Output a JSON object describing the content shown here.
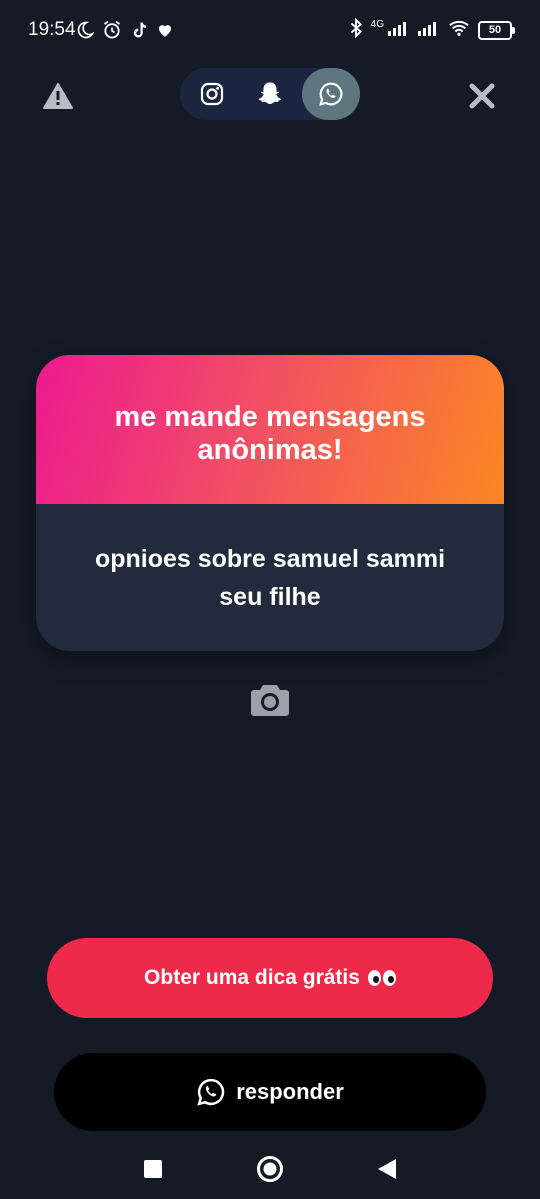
{
  "status_bar": {
    "time": "19:54",
    "network_tag": "4G",
    "battery": "50"
  },
  "share_bar": {
    "icons": [
      "instagram-icon",
      "snapchat-icon",
      "whatsapp-icon"
    ],
    "active": "whatsapp-icon"
  },
  "card": {
    "title": "me mande mensagens anônimas!",
    "message": "opnioes sobre samuel sammi seu filhe"
  },
  "hint_button": {
    "label": "Obter uma dica grátis"
  },
  "reply_button": {
    "label": "responder"
  },
  "colors": {
    "background": "#151a27",
    "card_body": "#212b3d",
    "gradient_start": "#ec1a8f",
    "gradient_end": "#fb8723",
    "hint_button": "#ee2a4a",
    "active_share": "#5e7680"
  }
}
